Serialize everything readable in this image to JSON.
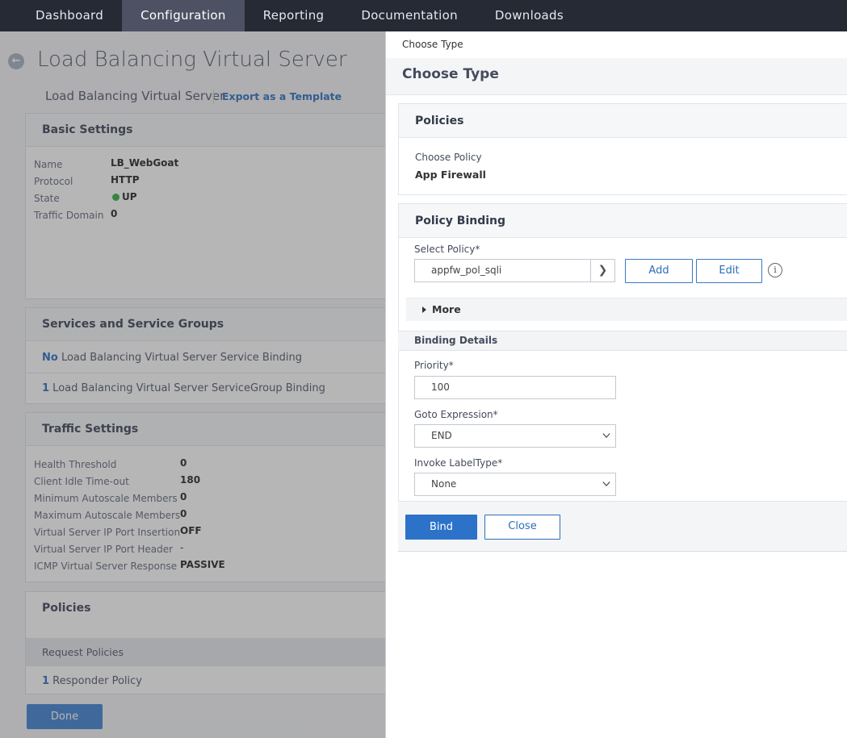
{
  "nav": {
    "tabs": [
      "Dashboard",
      "Configuration",
      "Reporting",
      "Documentation",
      "Downloads"
    ],
    "active_index": 1
  },
  "page": {
    "title": "Load Balancing Virtual Server",
    "breadcrumb": "Load Balancing Virtual Server",
    "export_link": "Export as a Template",
    "done_label": "Done"
  },
  "basic_settings": {
    "heading": "Basic Settings",
    "rows": [
      {
        "key": "Name",
        "value": "LB_WebGoat"
      },
      {
        "key": "Protocol",
        "value": "HTTP"
      },
      {
        "key": "State",
        "value": "UP"
      },
      {
        "key": "Traffic Domain",
        "value": "0"
      }
    ]
  },
  "services": {
    "heading": "Services and Service Groups",
    "row1_count": "No",
    "row1_text": " Load Balancing Virtual Server Service Binding",
    "row2_count": "1",
    "row2_text": " Load Balancing Virtual Server ServiceGroup Binding"
  },
  "traffic": {
    "heading": "Traffic Settings",
    "rows": [
      {
        "key": "Health Threshold",
        "value": "0"
      },
      {
        "key": "Client Idle Time-out",
        "value": "180"
      },
      {
        "key": "Minimum Autoscale Members",
        "value": "0"
      },
      {
        "key": "Maximum Autoscale Members",
        "value": "0"
      },
      {
        "key": "Virtual Server IP Port Insertion",
        "value": "OFF"
      },
      {
        "key": "Virtual Server IP Port Header",
        "value": "-"
      },
      {
        "key": "ICMP Virtual Server Response",
        "value": "PASSIVE"
      }
    ]
  },
  "bg_policies": {
    "heading": "Policies",
    "subheading": "Request Policies",
    "row_count": "1",
    "row_text": " Responder Policy"
  },
  "drawer": {
    "breadcrumb": "Choose Type",
    "title": "Choose Type",
    "policies_heading": "Policies",
    "choose_policy_label": "Choose Policy",
    "choose_policy_value": "App Firewall",
    "binding_heading": "Policy Binding",
    "select_policy_label": "Select Policy*",
    "select_policy_value": "appfw_pol_sqli",
    "add_label": "Add",
    "edit_label": "Edit",
    "more_label": "More",
    "binding_details_heading": "Binding Details",
    "priority_label": "Priority*",
    "priority_value": "100",
    "goto_label": "Goto Expression*",
    "goto_value": "END",
    "invoke_label": "Invoke LabelType*",
    "invoke_value": "None",
    "bind_label": "Bind",
    "close_label": "Close"
  },
  "colors": {
    "nav_bg": "#252a35",
    "accent": "#2c72c8",
    "status_up": "#40b34a"
  }
}
